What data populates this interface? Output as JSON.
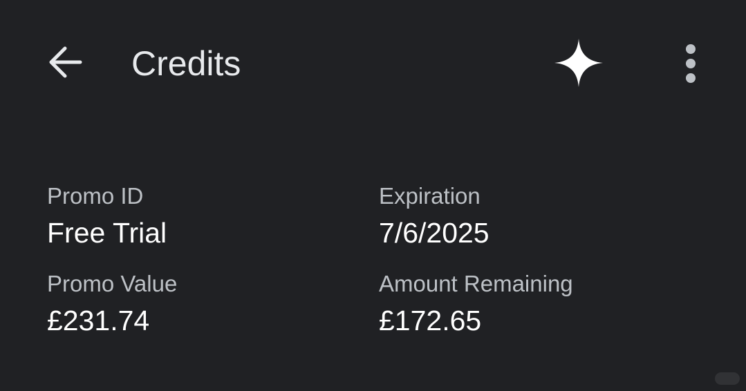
{
  "app_bar": {
    "title": "Credits",
    "back_icon": "arrow-back-icon",
    "sparkle_icon": "sparkle-icon",
    "more_icon": "more-vert-icon"
  },
  "details": {
    "promo_id": {
      "label": "Promo ID",
      "value": "Free Trial"
    },
    "expiration": {
      "label": "Expiration",
      "value": "7/6/2025"
    },
    "promo_value": {
      "label": "Promo Value",
      "value": "£231.74"
    },
    "amount_remaining": {
      "label": "Amount Remaining",
      "value": "£172.65"
    }
  },
  "colors": {
    "background": "#202124",
    "title": "#e8eaed",
    "label": "#bdc1c6",
    "value": "#ffffff"
  }
}
